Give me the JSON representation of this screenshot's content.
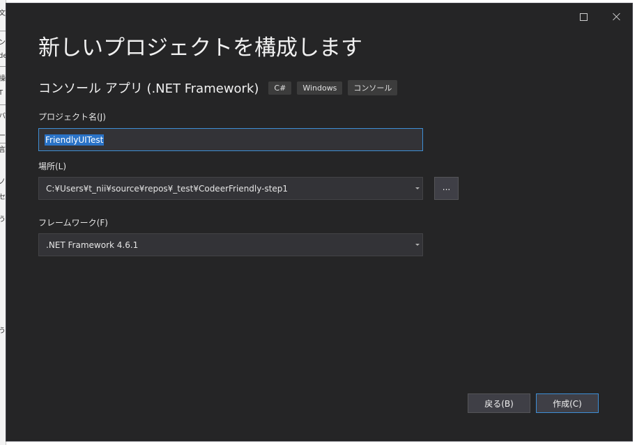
{
  "background_window": {
    "glyphs": [
      "文",
      "ン",
      "de",
      "操",
      "T",
      "バ",
      "ー",
      "言",
      "ノ",
      "セ",
      "う",
      "う"
    ]
  },
  "dialog": {
    "title": "新しいプロジェクトを構成します",
    "window_controls": {
      "maximize": "maximize-icon",
      "close": "close-icon"
    },
    "template": {
      "name": "コンソール アプリ (.NET Framework)",
      "tags": [
        "C#",
        "Windows",
        "コンソール"
      ]
    },
    "project_name": {
      "label": "プロジェクト名(J)",
      "value": "FriendlyUITest"
    },
    "location": {
      "label": "場所(L)",
      "value": "C:¥Users¥t_nii¥source¥repos¥_test¥CodeerFriendly-step1",
      "browse_label": "..."
    },
    "framework": {
      "label": "フレームワーク(F)",
      "value": ".NET Framework 4.6.1"
    },
    "buttons": {
      "back": "戻る(B)",
      "create": "作成(C)"
    }
  },
  "colors": {
    "dialog_bg": "#252526",
    "field_bg": "#333337",
    "accent": "#3e8fd6",
    "selection": "#2a73c7"
  }
}
